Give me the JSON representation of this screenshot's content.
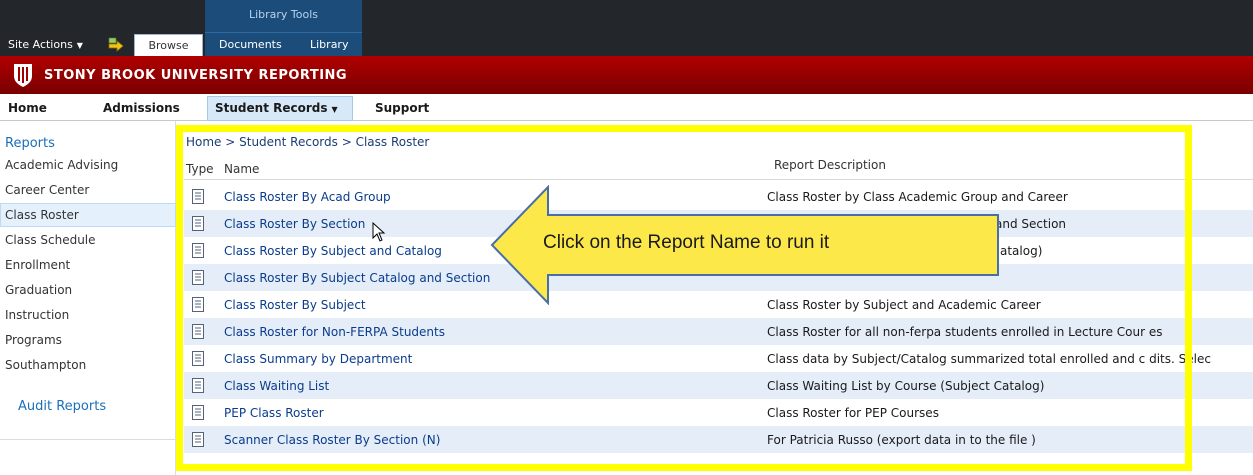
{
  "ribbon": {
    "context_tab_group": "Library Tools",
    "site_actions_label": "Site Actions",
    "tabs": [
      {
        "label": "Browse"
      },
      {
        "label": "Documents"
      },
      {
        "label": "Library"
      }
    ]
  },
  "banner": {
    "title": "STONY BROOK UNIVERSITY REPORTING"
  },
  "topnav": {
    "items": [
      {
        "label": "Home"
      },
      {
        "label": "Admissions"
      },
      {
        "label": "Student Records"
      },
      {
        "label": "Support"
      }
    ]
  },
  "leftnav": {
    "header": "Reports",
    "items": [
      {
        "label": "Academic Advising"
      },
      {
        "label": "Career Center"
      },
      {
        "label": "Class Roster"
      },
      {
        "label": "Class Schedule"
      },
      {
        "label": "Enrollment"
      },
      {
        "label": "Graduation"
      },
      {
        "label": "Instruction"
      },
      {
        "label": "Programs"
      },
      {
        "label": "Southampton"
      }
    ],
    "audit_header": "Audit Reports"
  },
  "main": {
    "breadcrumb": "Home > Student Records > Class Roster",
    "columns": {
      "type": "Type",
      "name": "Name",
      "description": "Report Description"
    },
    "rows": [
      {
        "name": "Class Roster By Acad Group",
        "description": "Class Roster by Class Academic Group and Career"
      },
      {
        "name": "Class Roster By Section",
        "description": "umber and Section"
      },
      {
        "name": "Class Roster By Subject and Catalog",
        "description": "atalog)"
      },
      {
        "name": "Class Roster By Subject Catalog and Section",
        "description": ""
      },
      {
        "name": "Class Roster By Subject",
        "description": "Class Roster by Subject and Academic Career"
      },
      {
        "name": "Class Roster for Non-FERPA Students",
        "description": "Class Roster for all non-ferpa students enrolled in Lecture Cour  es"
      },
      {
        "name": "Class Summary by Department",
        "description": "Class data by Subject/Catalog summarized total enrolled and c  dits. Selec"
      },
      {
        "name": "Class Waiting List",
        "description": "Class Waiting List by Course (Subject Catalog)"
      },
      {
        "name": "PEP Class Roster",
        "description": "Class Roster for PEP Courses"
      },
      {
        "name": "Scanner Class Roster By Section (N)",
        "description": "For Patricia Russo (export data in to the file )"
      }
    ]
  },
  "callout": {
    "text": "Click on the Report Name to run it"
  },
  "colors": {
    "ribbon_bg": "#23262b",
    "library_tools": "#1c4c7a",
    "banner_red": "#a00000",
    "link_blue": "#0a3c8c",
    "highlight_yellow": "#ffff00",
    "callout_fill": "#fde84a",
    "callout_stroke": "#4a6ea8"
  }
}
